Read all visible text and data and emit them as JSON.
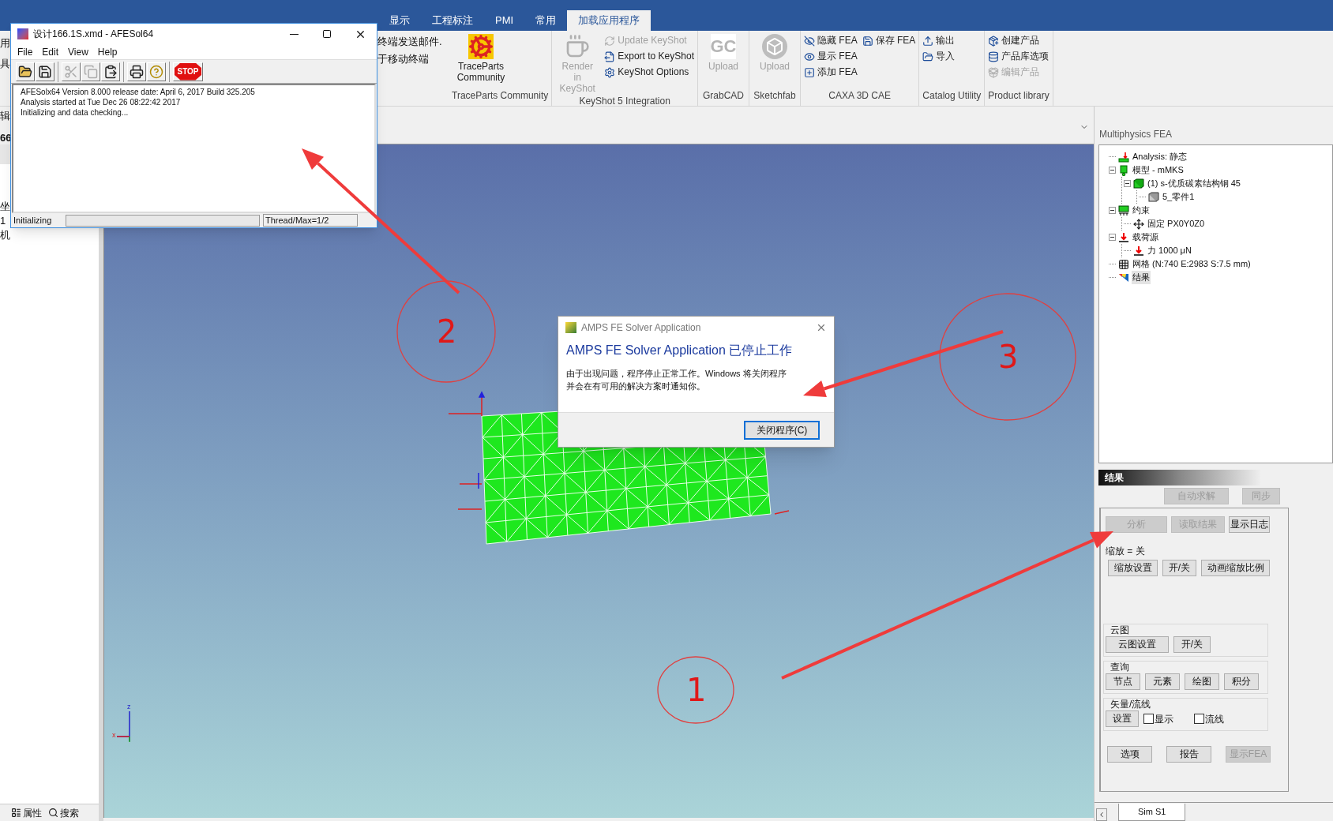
{
  "app_tabs": [
    {
      "label": "显示",
      "selected": false
    },
    {
      "label": "工程标注",
      "selected": false
    },
    {
      "label": "PMI",
      "selected": false
    },
    {
      "label": "常用",
      "selected": false
    },
    {
      "label": "加载应用程序",
      "selected": true
    }
  ],
  "ribbon": {
    "hidden_fragments": [
      "用",
      "具"
    ],
    "hidden_texts": [
      "终端发送邮件.",
      "于移动终端"
    ],
    "groups": [
      {
        "label": "TraceParts Community",
        "items": [
          {
            "kind": "large",
            "label": "TraceParts Community",
            "disabled": false
          }
        ]
      },
      {
        "label": "KeyShot 5 Integration",
        "items": [
          {
            "kind": "large",
            "label": "Render in KeyShot",
            "disabled": true
          },
          {
            "kind": "small",
            "label": "Update KeyShot",
            "disabled": true
          },
          {
            "kind": "small",
            "label": "Export to KeyShot",
            "disabled": false
          },
          {
            "kind": "small",
            "label": "KeyShot Options",
            "disabled": false
          }
        ]
      },
      {
        "label": "GrabCAD",
        "items": [
          {
            "kind": "large",
            "label": "Upload",
            "disabled": true,
            "logo_text": "GC"
          }
        ]
      },
      {
        "label": "Sketchfab",
        "items": [
          {
            "kind": "large",
            "label": "Upload",
            "disabled": true
          }
        ]
      },
      {
        "label": "CAXA 3D CAE",
        "items": [
          {
            "kind": "small",
            "label": "隐藏 FEA",
            "disabled": false
          },
          {
            "kind": "small",
            "label": "显示 FEA",
            "disabled": false
          },
          {
            "kind": "small",
            "label": "添加 FEA",
            "disabled": false
          },
          {
            "kind": "small",
            "label": "保存 FEA",
            "disabled": false
          }
        ]
      },
      {
        "label": "Catalog Utility",
        "items": [
          {
            "kind": "small",
            "label": "输出",
            "disabled": false
          },
          {
            "kind": "small",
            "label": "导入",
            "disabled": false
          }
        ]
      },
      {
        "label": "Product library",
        "items": [
          {
            "kind": "small",
            "label": "创建产品",
            "disabled": false
          },
          {
            "kind": "small",
            "label": "产品库选项",
            "disabled": false
          },
          {
            "kind": "small",
            "label": "编辑产品",
            "disabled": true
          }
        ]
      }
    ]
  },
  "left_panel": {
    "fragments": [
      "辑",
      "66",
      "坐",
      "1",
      "机"
    ],
    "tabs": [
      "属性",
      "搜索"
    ]
  },
  "viewport": {
    "axis_labels": [
      "z",
      "x"
    ]
  },
  "annotations": [
    {
      "label": "2"
    },
    {
      "label": "3"
    },
    {
      "label": "1"
    }
  ],
  "solver_window": {
    "title": "设计166.1S.xmd - AFESol64",
    "menu": [
      "File",
      "Edit",
      "View",
      "Help"
    ],
    "toolbar": [
      {
        "kind": "open",
        "disabled": false
      },
      {
        "kind": "save",
        "disabled": false
      },
      {
        "kind": "cut",
        "disabled": true
      },
      {
        "kind": "copy",
        "disabled": true
      },
      {
        "kind": "paste",
        "disabled": false
      },
      {
        "kind": "print",
        "disabled": false
      },
      {
        "kind": "help",
        "disabled": false
      },
      {
        "kind": "stop",
        "disabled": false,
        "label": "STOP"
      }
    ],
    "log": [
      "AFESolx64 Version 8.000 release date: April 6, 2017 Build 325.205",
      "Analysis started at Tue Dec 26 08:22:42 2017",
      "Initializing and data checking..."
    ],
    "status": "Initializing",
    "progress": {
      "level": 0
    },
    "threads": "Thread/Max=1/2"
  },
  "error_dialog": {
    "title": "AMPS FE Solver Application",
    "heading": "AMPS FE Solver Application 已停止工作",
    "body": [
      "由于出现问题，程序停止正常工作。Windows 将关闭程序",
      "并会在有可用的解决方案时通知你。"
    ],
    "button": "关闭程序(C)"
  },
  "fea_panel": {
    "title": "Multiphysics FEA",
    "tree": [
      {
        "label": "Analysis: 静态",
        "selected": false
      },
      {
        "label": "模型 - mMKS",
        "selected": false,
        "expanded": true,
        "children": [
          {
            "label": "(1) s-优质碳素结构钢 45",
            "selected": false,
            "expanded": true,
            "children": [
              {
                "label": "5_零件1",
                "selected": false
              }
            ]
          }
        ]
      },
      {
        "label": "约束",
        "selected": false,
        "expanded": true,
        "children": [
          {
            "label": "固定 PX0Y0Z0",
            "selected": false
          }
        ]
      },
      {
        "label": "载荷源",
        "selected": false,
        "expanded": true,
        "children": [
          {
            "label": "力 1000 μN",
            "selected": false
          }
        ]
      },
      {
        "label": "网格 (N:740 E:2983 S:7.5 mm)",
        "selected": false
      },
      {
        "label": "结果",
        "selected": true
      }
    ],
    "results_title": "结果",
    "top_buttons": [
      {
        "label": "自动求解",
        "disabled": true
      },
      {
        "label": "同步",
        "disabled": true
      }
    ],
    "action_buttons": [
      {
        "label": "分析",
        "disabled": true
      },
      {
        "label": "读取结果",
        "disabled": true
      },
      {
        "label": "显示日志",
        "disabled": false
      }
    ],
    "scale_status": "缩放 = 关",
    "scale_buttons": [
      {
        "label": "缩放设置",
        "disabled": false
      },
      {
        "label": "开/关",
        "disabled": false
      },
      {
        "label": "动画缩放比例",
        "disabled": false
      }
    ],
    "groups": [
      {
        "title": "云图",
        "controls": [
          {
            "kind": "button",
            "label": "云图设置"
          },
          {
            "kind": "button",
            "label": "开/关"
          }
        ]
      },
      {
        "title": "查询",
        "controls": [
          {
            "kind": "button",
            "label": "节点"
          },
          {
            "kind": "button",
            "label": "元素"
          },
          {
            "kind": "button",
            "label": "绘图"
          },
          {
            "kind": "button",
            "label": "积分"
          }
        ]
      },
      {
        "title": "矢量/流线",
        "controls": [
          {
            "kind": "button",
            "label": "设置"
          },
          {
            "kind": "checkbox",
            "label": "显示",
            "checked": false
          },
          {
            "kind": "checkbox",
            "label": "流线",
            "checked": false
          }
        ]
      }
    ],
    "bottom_buttons": [
      {
        "label": "选项",
        "disabled": false
      },
      {
        "label": "报告",
        "disabled": false
      },
      {
        "label": "显示FEA",
        "disabled": true
      }
    ],
    "sheet_tabs": [
      {
        "label": "Sim S1",
        "selected": true
      }
    ]
  }
}
